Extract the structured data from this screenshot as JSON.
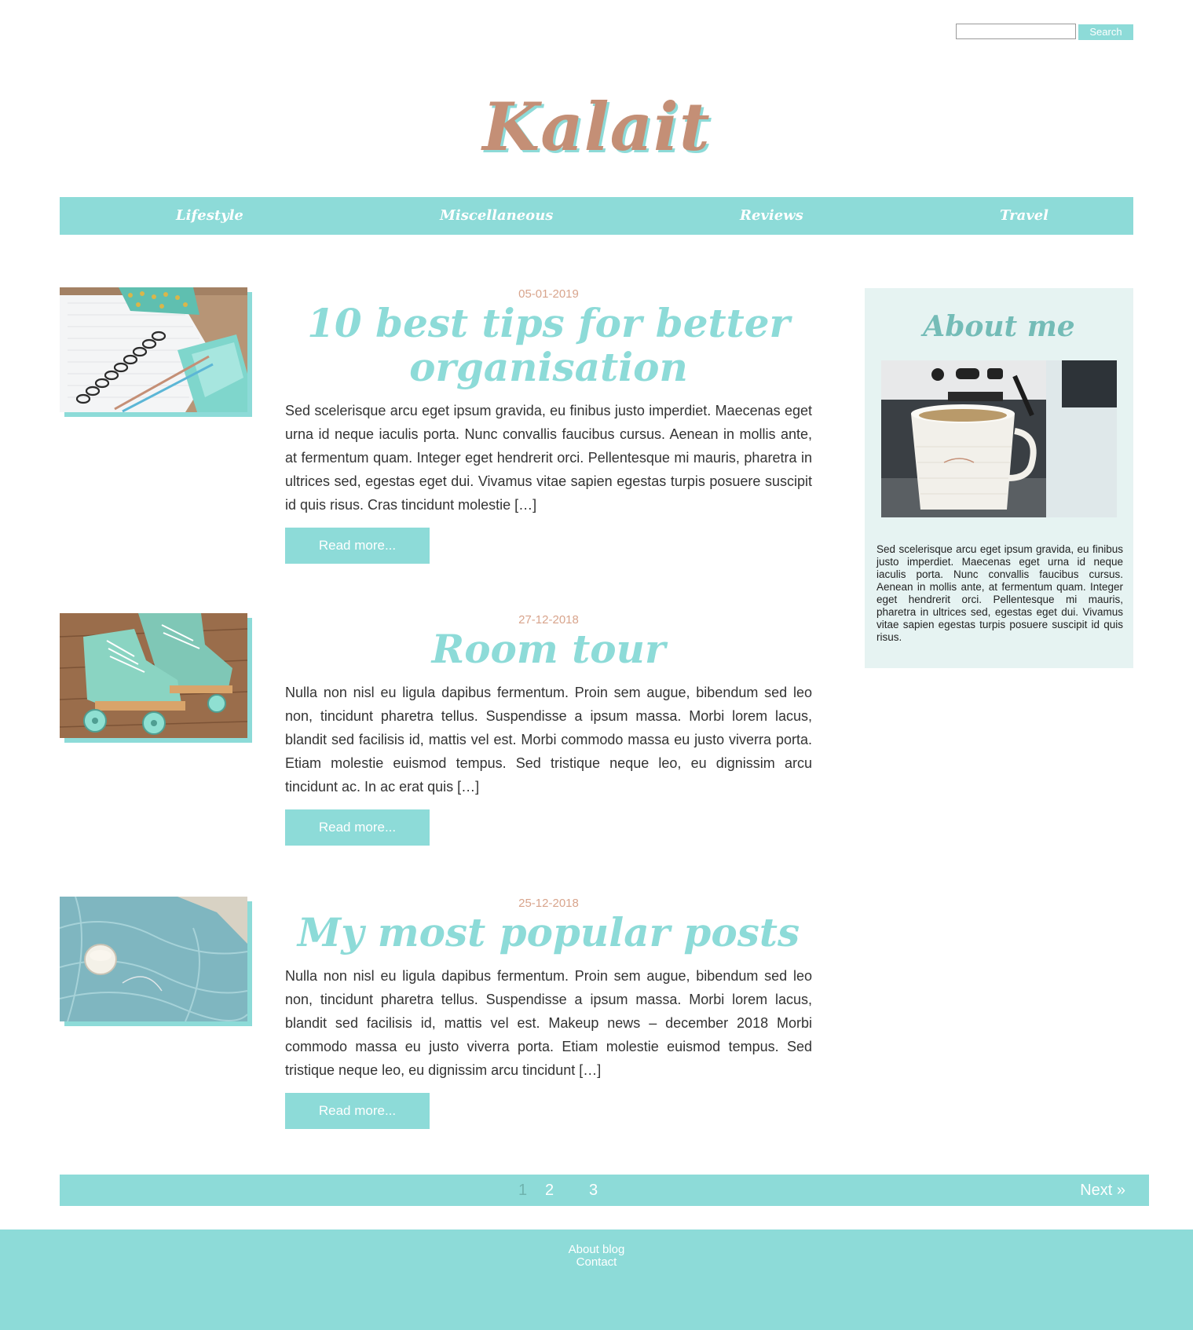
{
  "header": {
    "search_placeholder": "",
    "search_button": "Search",
    "logo": "Kalait"
  },
  "nav": {
    "items": [
      {
        "label": "Lifestyle"
      },
      {
        "label": "Miscellaneous"
      },
      {
        "label": "Reviews"
      },
      {
        "label": "Travel"
      }
    ]
  },
  "posts": [
    {
      "date": "05-01-2019",
      "title": "10 best tips for better organisation",
      "excerpt": "Sed scelerisque arcu eget ipsum gravida, eu finibus justo imperdiet. Maecenas eget urna id neque iaculis porta. Nunc convallis faucibus cursus. Aenean in mollis ante, at fermentum quam. Integer eget hendrerit orci. Pellentesque mi mauris, pharetra in ultrices sed, egestas eget dui. Vivamus vitae sapien egestas turpis posuere suscipit id quis risus. Cras tincidunt molestie […]",
      "read_more": "Read more..."
    },
    {
      "date": "27-12-2018",
      "title": "Room tour",
      "excerpt": "Nulla non nisl eu ligula dapibus fermentum. Proin sem augue, bibendum sed leo non, tincidunt pharetra tellus. Suspendisse a ipsum massa. Morbi lorem lacus, blandit sed facilisis id, mattis vel est. Morbi commodo massa eu justo viverra porta. Etiam molestie euismod tempus. Sed tristique neque leo, eu dignissim arcu tincidunt ac. In ac erat quis […]",
      "read_more": "Read more..."
    },
    {
      "date": "25-12-2018",
      "title": "My most popular posts",
      "excerpt": "Nulla non nisl eu ligula dapibus fermentum. Proin sem augue, bibendum sed leo non, tincidunt pharetra tellus. Suspendisse a ipsum massa. Morbi lorem lacus, blandit sed facilisis id, mattis vel est. Makeup news – december 2018 Morbi commodo massa eu justo viverra porta. Etiam molestie euismod tempus. Sed tristique neque leo, eu dignissim arcu tincidunt […]",
      "read_more": "Read more..."
    }
  ],
  "sidebar": {
    "title": "About me",
    "text": "Sed scelerisque arcu eget ipsum gravida, eu finibus justo imperdiet. Maecenas eget urna id neque iaculis porta. Nunc convallis faucibus cursus. Aenean in mollis ante, at fermentum quam. Integer eget hendrerit orci. Pellentesque mi mauris, pharetra in ultrices sed, egestas eget dui. Vivamus vitae sapien egestas turpis posuere suscipit id quis risus."
  },
  "pagination": {
    "pages": [
      "1",
      "2",
      "3"
    ],
    "current": "1",
    "next": "Next »"
  },
  "footer": {
    "links": [
      "About blog",
      "Contact"
    ]
  },
  "colors": {
    "accent": "#8ddbd8",
    "logo": "#c48f76",
    "date": "#d8a48c",
    "sidebar_bg": "#e6f3f2"
  }
}
